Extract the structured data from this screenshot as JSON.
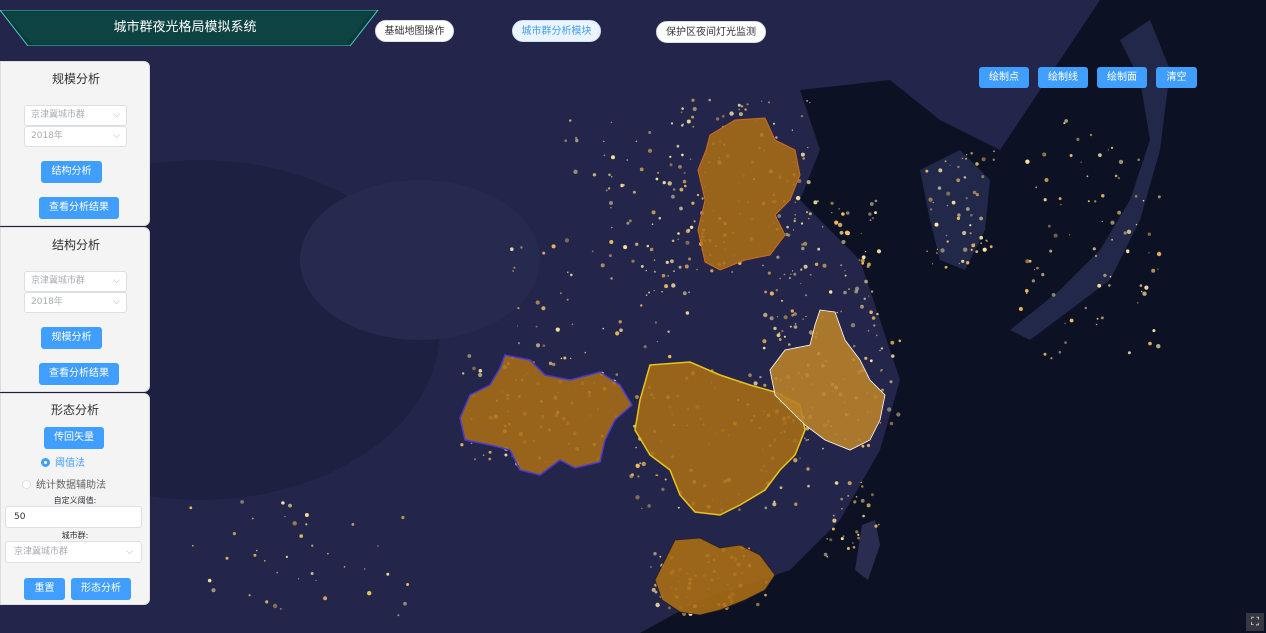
{
  "header": {
    "title": "城市群夜光格局模拟系统",
    "modules": [
      {
        "label": "基础地图操作",
        "active": false
      },
      {
        "label": "城市群分析模块",
        "active": true
      },
      {
        "label": "保护区夜间灯光监测",
        "active": false
      }
    ]
  },
  "draw_toolbar": {
    "point": "绘制点",
    "line": "绘制线",
    "polygon": "绘制面",
    "clear": "清空"
  },
  "scale_panel": {
    "title": "规模分析",
    "region_select": "京津冀城市群",
    "year_select": "2018年",
    "analyze_button": "结构分析",
    "result_button": "查看分析结果"
  },
  "structure_panel": {
    "title": "结构分析",
    "region_select": "京津冀城市群",
    "year_select": "2018年",
    "analyze_button": "规模分析",
    "result_button": "查看分析结果"
  },
  "morph_panel": {
    "title": "形态分析",
    "upload_button": "传回矢量",
    "method_threshold": "阈值法",
    "method_stats": "统计数据辅助法",
    "threshold_label": "自定义阈值:",
    "threshold_value": "50",
    "cluster_label": "城市群:",
    "cluster_select": "京津冀城市群",
    "reset_button": "重置",
    "analyze_button": "形态分析"
  },
  "colors": {
    "accent": "#409eff",
    "map_background": "#1b1d36",
    "region_fill": "#a86d15",
    "region_border_yellow": "#e8c51a"
  },
  "icons": {
    "fullscreen": "fullscreen-icon",
    "chevron": "chevron-down-icon"
  }
}
